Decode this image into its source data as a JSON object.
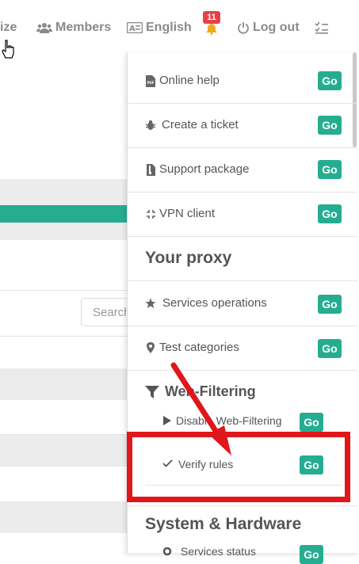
{
  "topbar": {
    "partial_item": "ize",
    "members": "Members",
    "language": "English",
    "notifications_count": "11",
    "logout": "Log out"
  },
  "background": {
    "search_placeholder": "Search"
  },
  "menu": {
    "items": [
      {
        "label": "Online help",
        "icon": "pdf-file-icon",
        "go": "Go"
      },
      {
        "label": "Create a ticket",
        "icon": "bug-icon",
        "go": "Go"
      },
      {
        "label": "Support package",
        "icon": "package-file-icon",
        "go": "Go"
      },
      {
        "label": "VPN client",
        "icon": "compress-icon",
        "go": "Go"
      }
    ],
    "proxy_section": "Your proxy",
    "proxy_items": [
      {
        "label": "Services operations",
        "icon": "star-icon",
        "go": "Go"
      },
      {
        "label": "Test categories",
        "icon": "map-marker-icon",
        "go": "Go"
      }
    ],
    "web_filtering_section": "Web-Filtering",
    "web_filtering_items": [
      {
        "label": "Disable Web-Filtering",
        "icon": "play-icon",
        "go": "Go"
      },
      {
        "label": "Verify rules",
        "icon": "check-icon",
        "go": "Go"
      }
    ],
    "system_section": "System & Hardware",
    "system_items": [
      {
        "label": "Services status",
        "icon": "gear-icon",
        "go": "Go"
      }
    ]
  },
  "colors": {
    "accent": "#26ad91",
    "badge": "#e8404a",
    "annotation": "#e0161b"
  }
}
